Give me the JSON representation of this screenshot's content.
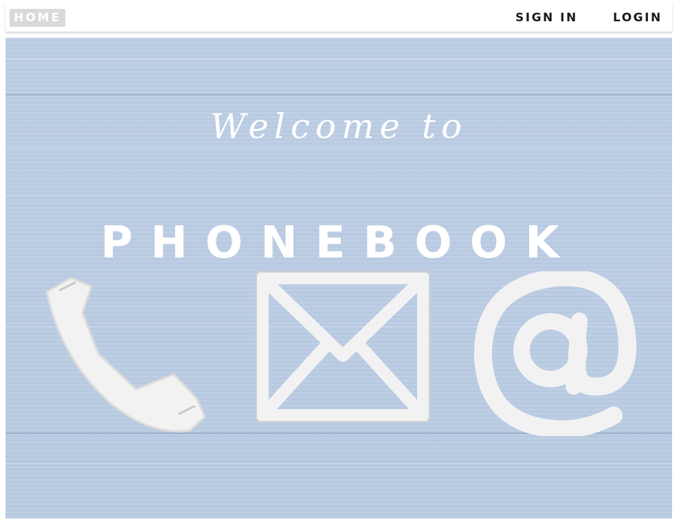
{
  "nav": {
    "home_label": "HOME",
    "signin_label": "SIGN IN",
    "login_label": "LOGIN"
  },
  "hero": {
    "welcome_text": "Welcome to",
    "title_text": "PHONEBOOK",
    "background_color": "#b9cbe2",
    "icons": [
      "phone-icon",
      "mail-icon",
      "at-icon"
    ]
  }
}
